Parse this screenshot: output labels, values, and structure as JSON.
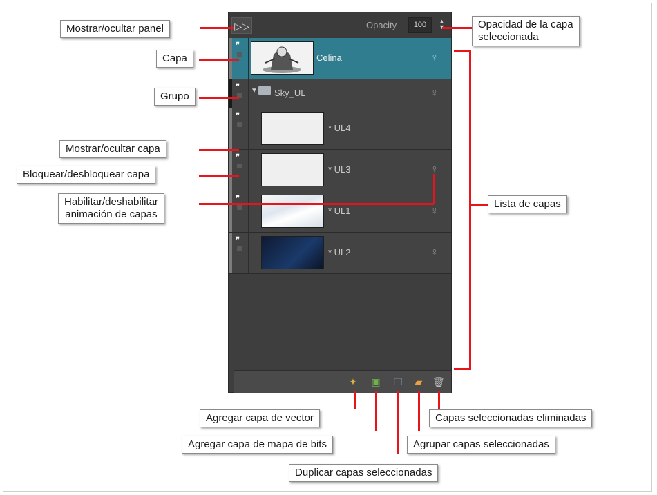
{
  "panel": {
    "opacity_label": "Opacity",
    "opacity_value": "100",
    "toggle_icon": "double-chevron-right-icon",
    "layers": [
      {
        "name": "Celina",
        "type": "drawing",
        "selected": true
      },
      {
        "name": "Sky_UL",
        "type": "group",
        "selected": false
      },
      {
        "name": "* UL4",
        "type": "child",
        "selected": false
      },
      {
        "name": "* UL3",
        "type": "child",
        "selected": false
      },
      {
        "name": "* UL1",
        "type": "child",
        "selected": false
      },
      {
        "name": "* UL2",
        "type": "child",
        "selected": false
      }
    ],
    "bottom_tools": [
      "add-vector-layer-icon",
      "add-bitmap-layer-icon",
      "duplicate-layers-icon",
      "group-layers-icon",
      "delete-layers-icon"
    ],
    "selected_color": "#2f7d8f"
  },
  "callouts": {
    "toggle_panel": "Mostrar/ocultar panel",
    "layer": "Capa",
    "group": "Grupo",
    "show_hide_layer": "Mostrar/ocultar capa",
    "lock_unlock_layer": "Bloquear/desbloquear capa",
    "enable_animation_1": "Habilitar/deshabilitar",
    "enable_animation_2": "animación de capas",
    "opacity_1": "Opacidad de la capa",
    "opacity_2": "seleccionada",
    "layer_list": "Lista de capas",
    "add_vector": "Agregar capa de vector",
    "add_bitmap": "Agregar capa de mapa de bits",
    "duplicate": "Duplicar capas seleccionadas",
    "group_selected": "Agrupar capas seleccionadas",
    "delete_selected": "Capas seleccionadas eliminadas"
  },
  "annotation_color": "#e8131b"
}
